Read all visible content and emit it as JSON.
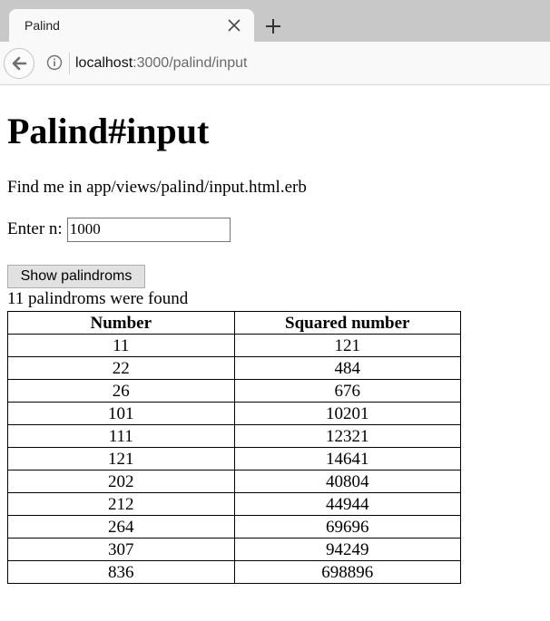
{
  "browser": {
    "tab_title": "Palind",
    "url_host": "localhost",
    "url_path": ":3000/palind/input"
  },
  "page": {
    "heading": "Palind#input",
    "hint": "Find me in app/views/palind/input.html.erb",
    "input_label": "Enter n:",
    "input_value": "1000",
    "submit_label": "Show palindroms",
    "found_text": "11 palindroms were found"
  },
  "table": {
    "headers": [
      "Number",
      "Squared number"
    ],
    "rows": [
      [
        "11",
        "121"
      ],
      [
        "22",
        "484"
      ],
      [
        "26",
        "676"
      ],
      [
        "101",
        "10201"
      ],
      [
        "111",
        "12321"
      ],
      [
        "121",
        "14641"
      ],
      [
        "202",
        "40804"
      ],
      [
        "212",
        "44944"
      ],
      [
        "264",
        "69696"
      ],
      [
        "307",
        "94249"
      ],
      [
        "836",
        "698896"
      ]
    ]
  },
  "icons": {
    "tab_close": "close-icon",
    "new_tab": "plus-icon",
    "back": "back-arrow-icon",
    "site_info": "info-icon"
  }
}
